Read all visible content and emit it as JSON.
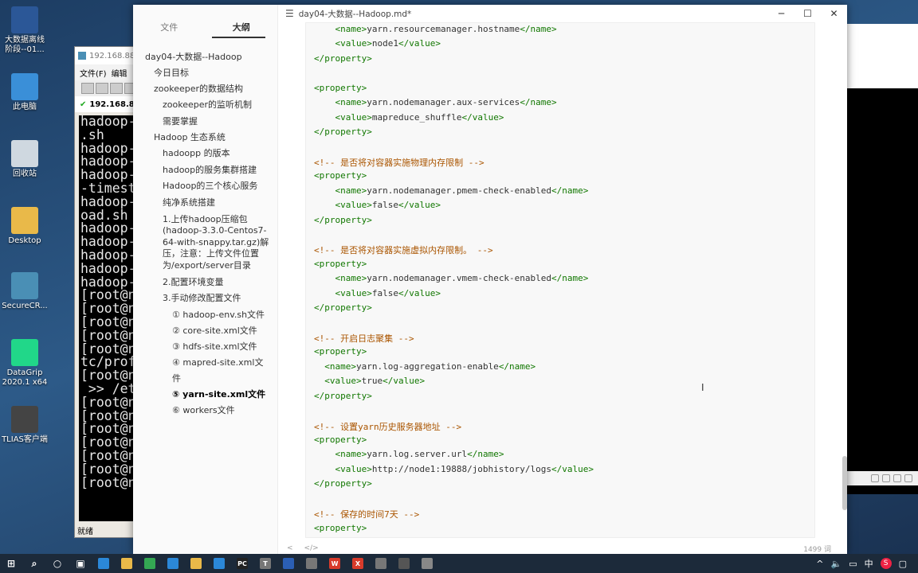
{
  "desktop": {
    "icons": [
      {
        "label": "大数据离线阶段--01...",
        "icon": "word-doc-icon",
        "color": "#2b5797"
      },
      {
        "label": "此电脑",
        "icon": "this-pc-icon",
        "color": "#3a8fd8"
      },
      {
        "label": "回收站",
        "icon": "recycle-bin-icon",
        "color": "#cfd8e0"
      },
      {
        "label": "Desktop",
        "icon": "folder-icon",
        "color": "#e9b949"
      },
      {
        "label": "SecureCR...",
        "icon": "securecrt-icon",
        "color": "#4a8fb5"
      },
      {
        "label": "DataGrip 2020.1 x64",
        "icon": "datagrip-icon",
        "color": "#21d789"
      },
      {
        "label": "TLIAS客户端",
        "icon": "tlias-client-icon",
        "color": "#444"
      }
    ]
  },
  "securecrt": {
    "title": "192.168.88...",
    "menu": [
      "文件(F)",
      "编辑"
    ],
    "session_tab": "192.168.88.1",
    "terminal_lines": [
      "hadoop-",
      ".sh",
      "hadoop-",
      "hadoop-",
      "hadoop-",
      "-timest",
      "hadoop-",
      "oad.sh",
      "hadoop-",
      "hadoop-",
      "hadoop-",
      "hadoop-",
      "hadoop-",
      "[root@n",
      "[root@n",
      "[root@n",
      "[root@n",
      "[root@n",
      "tc/prof",
      "[root@n",
      " >> /et",
      "[root@n",
      "[root@n",
      "[root@n",
      "[root@n",
      "[root@n",
      "[root@n",
      "[root@n"
    ],
    "status": "就绪"
  },
  "typora": {
    "sidebar": {
      "tabs": [
        "文件",
        "大纲"
      ],
      "active_tab": "大纲",
      "outline": [
        {
          "level": 1,
          "text": "day04-大数据--Hadoop"
        },
        {
          "level": 2,
          "text": "今日目标"
        },
        {
          "level": 2,
          "text": "zookeeper的数据结构"
        },
        {
          "level": 3,
          "text": "zookeeper的监听机制"
        },
        {
          "level": 3,
          "text": "需要掌握"
        },
        {
          "level": 2,
          "text": "Hadoop 生态系统"
        },
        {
          "level": 3,
          "text": "hadoopp 的版本"
        },
        {
          "level": 3,
          "text": "hadoop的服务集群搭建"
        },
        {
          "level": 3,
          "text": "Hadoop的三个核心服务"
        },
        {
          "level": 3,
          "text": "纯净系统搭建"
        },
        {
          "level": 3,
          "text": "1.上传hadoop压缩包(hadoop-3.3.0-Centos7-64-with-snappy.tar.gz)解压，注意：上传文件位置为/export/server目录"
        },
        {
          "level": 3,
          "text": "2.配置环境变量"
        },
        {
          "level": 3,
          "text": "3.手动修改配置文件"
        },
        {
          "level": 4,
          "text": "① hadoop-env.sh文件"
        },
        {
          "level": 4,
          "text": "② core-site.xml文件"
        },
        {
          "level": 4,
          "text": "③ hdfs-site.xml文件"
        },
        {
          "level": 4,
          "text": "④ mapred-site.xml文件"
        },
        {
          "level": 4,
          "text": "⑤ yarn-site.xml文件",
          "active": true
        },
        {
          "level": 4,
          "text": "⑥ workers文件"
        }
      ]
    },
    "title": "day04-大数据--Hadoop.md*",
    "window_buttons": {
      "minimize": "─",
      "maximize": "☐",
      "close": "✕"
    },
    "code_lines": [
      {
        "indent": "    ",
        "parts": [
          [
            "tag",
            "<name>"
          ],
          [
            "txt",
            "yarn.resourcemanager.hostname"
          ],
          [
            "tag",
            "</name>"
          ]
        ]
      },
      {
        "indent": "    ",
        "parts": [
          [
            "tag",
            "<value>"
          ],
          [
            "txt",
            "node1"
          ],
          [
            "tag",
            "</value>"
          ]
        ]
      },
      {
        "indent": "",
        "parts": [
          [
            "tag",
            "</property>"
          ]
        ]
      },
      {
        "indent": "",
        "parts": []
      },
      {
        "indent": "",
        "parts": [
          [
            "tag",
            "<property>"
          ]
        ]
      },
      {
        "indent": "    ",
        "parts": [
          [
            "tag",
            "<name>"
          ],
          [
            "txt",
            "yarn.nodemanager.aux-services"
          ],
          [
            "tag",
            "</name>"
          ]
        ]
      },
      {
        "indent": "    ",
        "parts": [
          [
            "tag",
            "<value>"
          ],
          [
            "txt",
            "mapreduce_shuffle"
          ],
          [
            "tag",
            "</value>"
          ]
        ]
      },
      {
        "indent": "",
        "parts": [
          [
            "tag",
            "</property>"
          ]
        ]
      },
      {
        "indent": "",
        "parts": []
      },
      {
        "indent": "",
        "parts": [
          [
            "cm",
            "<!-- 是否将对容器实施物理内存限制 -->"
          ]
        ]
      },
      {
        "indent": "",
        "parts": [
          [
            "tag",
            "<property>"
          ]
        ]
      },
      {
        "indent": "    ",
        "parts": [
          [
            "tag",
            "<name>"
          ],
          [
            "txt",
            "yarn.nodemanager.pmem-check-enabled"
          ],
          [
            "tag",
            "</name>"
          ]
        ]
      },
      {
        "indent": "    ",
        "parts": [
          [
            "tag",
            "<value>"
          ],
          [
            "txt",
            "false"
          ],
          [
            "tag",
            "</value>"
          ]
        ]
      },
      {
        "indent": "",
        "parts": [
          [
            "tag",
            "</property>"
          ]
        ]
      },
      {
        "indent": "",
        "parts": []
      },
      {
        "indent": "",
        "parts": [
          [
            "cm",
            "<!-- 是否将对容器实施虚拟内存限制。 -->"
          ]
        ]
      },
      {
        "indent": "",
        "parts": [
          [
            "tag",
            "<property>"
          ]
        ]
      },
      {
        "indent": "    ",
        "parts": [
          [
            "tag",
            "<name>"
          ],
          [
            "txt",
            "yarn.nodemanager.vmem-check-enabled"
          ],
          [
            "tag",
            "</name>"
          ]
        ]
      },
      {
        "indent": "    ",
        "parts": [
          [
            "tag",
            "<value>"
          ],
          [
            "txt",
            "false"
          ],
          [
            "tag",
            "</value>"
          ]
        ]
      },
      {
        "indent": "",
        "parts": [
          [
            "tag",
            "</property>"
          ]
        ]
      },
      {
        "indent": "",
        "parts": []
      },
      {
        "indent": "",
        "parts": [
          [
            "cm",
            "<!-- 开启日志聚集 -->"
          ]
        ]
      },
      {
        "indent": "",
        "parts": [
          [
            "tag",
            "<property>"
          ]
        ]
      },
      {
        "indent": "  ",
        "parts": [
          [
            "tag",
            "<name>"
          ],
          [
            "txt",
            "yarn.log-aggregation-enable"
          ],
          [
            "tag",
            "</name>"
          ]
        ]
      },
      {
        "indent": "  ",
        "parts": [
          [
            "tag",
            "<value>"
          ],
          [
            "txt",
            "true"
          ],
          [
            "tag",
            "</value>"
          ]
        ]
      },
      {
        "indent": "",
        "parts": [
          [
            "tag",
            "</property>"
          ]
        ]
      },
      {
        "indent": "",
        "parts": []
      },
      {
        "indent": "",
        "parts": [
          [
            "cm",
            "<!-- 设置yarn历史服务器地址 -->"
          ]
        ]
      },
      {
        "indent": "",
        "parts": [
          [
            "tag",
            "<property>"
          ]
        ]
      },
      {
        "indent": "    ",
        "parts": [
          [
            "tag",
            "<name>"
          ],
          [
            "txt",
            "yarn.log.server.url"
          ],
          [
            "tag",
            "</name>"
          ]
        ]
      },
      {
        "indent": "    ",
        "parts": [
          [
            "tag",
            "<value>"
          ],
          [
            "txt",
            "http://node1:19888/jobhistory/logs"
          ],
          [
            "tag",
            "</value>"
          ]
        ]
      },
      {
        "indent": "",
        "parts": [
          [
            "tag",
            "</property>"
          ]
        ]
      },
      {
        "indent": "",
        "parts": []
      },
      {
        "indent": "",
        "parts": [
          [
            "cm",
            "<!-- 保存的时间7天 -->"
          ]
        ]
      },
      {
        "indent": "",
        "parts": [
          [
            "tag",
            "<property>"
          ]
        ]
      }
    ],
    "statusbar": {
      "left_icons": [
        "arrow-left-icon",
        "code-toggle-icon"
      ],
      "word_count": "1499 词"
    }
  },
  "taskbar": {
    "apps": [
      {
        "name": "windows-start-icon",
        "color": "#fff",
        "label": ""
      },
      {
        "name": "search-icon",
        "color": "#fff",
        "label": ""
      },
      {
        "name": "cortana-icon",
        "color": "#fff",
        "label": ""
      },
      {
        "name": "task-view-icon",
        "color": "#fff",
        "label": ""
      },
      {
        "name": "store-icon",
        "color": "#2b88d8",
        "label": ""
      },
      {
        "name": "file-explorer-icon",
        "color": "#e9b949",
        "label": ""
      },
      {
        "name": "chrome-icon",
        "color": "#34a853",
        "label": ""
      },
      {
        "name": "edge-icon",
        "color": "#2b88d8",
        "label": ""
      },
      {
        "name": "folder-app-icon",
        "color": "#e9b949",
        "label": ""
      },
      {
        "name": "vscode-icon",
        "color": "#2b88d8",
        "label": ""
      },
      {
        "name": "pycharm-icon",
        "color": "#222",
        "label": "PC"
      },
      {
        "name": "typora-icon",
        "color": "#777",
        "label": "T"
      },
      {
        "name": "app-blue-icon",
        "color": "#2b5fb5",
        "label": ""
      },
      {
        "name": "settings-app-icon",
        "color": "#777",
        "label": ""
      },
      {
        "name": "wps-icon",
        "color": "#d83b2b",
        "label": "W"
      },
      {
        "name": "xmind-icon",
        "color": "#d83b2b",
        "label": "X"
      },
      {
        "name": "browser-icon",
        "color": "#777",
        "label": ""
      },
      {
        "name": "remote-desktop-icon",
        "color": "#555",
        "label": ""
      },
      {
        "name": "package-icon",
        "color": "#888",
        "label": ""
      }
    ],
    "tray": [
      "^",
      "volume-icon",
      "network-icon",
      "中",
      "S"
    ]
  }
}
